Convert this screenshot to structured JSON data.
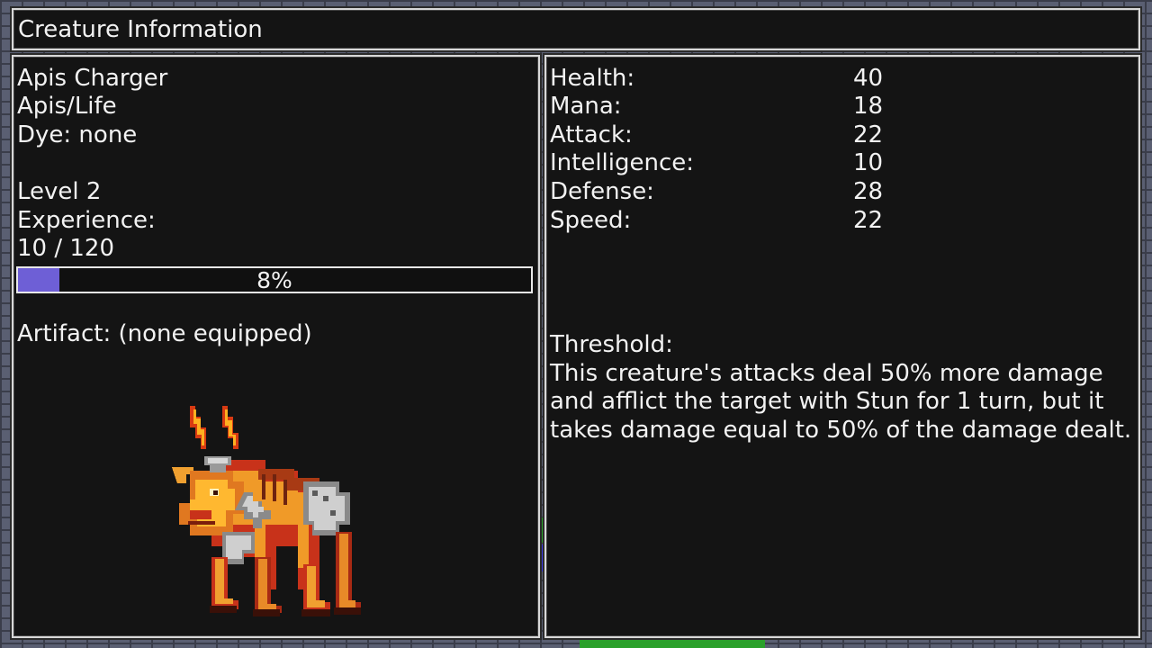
{
  "window": {
    "title": "Creature Information"
  },
  "creature": {
    "name": "Apis Charger",
    "type": "Apis/Life",
    "dye": "Dye: none",
    "level": "Level 2",
    "experience_label": "Experience:",
    "experience_value": "10 / 120",
    "experience_percent_text": "8%",
    "experience_fraction": 0.08,
    "artifact": "Artifact: (none equipped)",
    "sprite_icon": "apis-charger-sprite"
  },
  "stats": [
    {
      "label": "Health:",
      "value": "40"
    },
    {
      "label": "Mana:",
      "value": "18"
    },
    {
      "label": "Attack:",
      "value": "22"
    },
    {
      "label": "Intelligence:",
      "value": "10"
    },
    {
      "label": "Defense:",
      "value": "28"
    },
    {
      "label": "Speed:",
      "value": "22"
    }
  ],
  "trait": {
    "heading": "Threshold:",
    "description": "This creature's attacks deal 50% more damage and afflict the target with Stun for 1 turn, but it takes damage equal to 50% of the damage dealt."
  },
  "colors": {
    "panel_bg": "#141414",
    "panel_border": "#d8d8d8",
    "xp_fill": "#6e5fd6",
    "text": "#f2f2f2"
  }
}
